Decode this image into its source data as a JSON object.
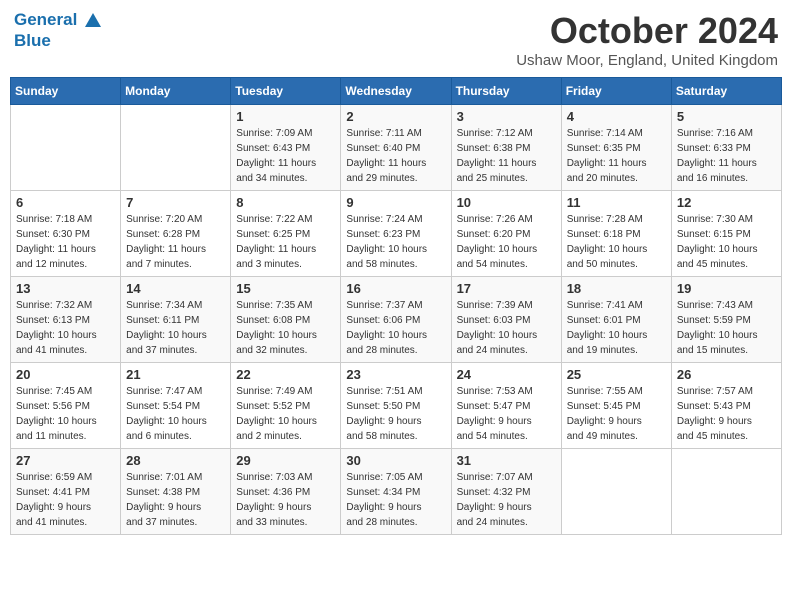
{
  "header": {
    "logo_line1": "General",
    "logo_line2": "Blue",
    "month_title": "October 2024",
    "location": "Ushaw Moor, England, United Kingdom"
  },
  "days_of_week": [
    "Sunday",
    "Monday",
    "Tuesday",
    "Wednesday",
    "Thursday",
    "Friday",
    "Saturday"
  ],
  "weeks": [
    [
      {
        "day": "",
        "info": ""
      },
      {
        "day": "",
        "info": ""
      },
      {
        "day": "1",
        "info": "Sunrise: 7:09 AM\nSunset: 6:43 PM\nDaylight: 11 hours\nand 34 minutes."
      },
      {
        "day": "2",
        "info": "Sunrise: 7:11 AM\nSunset: 6:40 PM\nDaylight: 11 hours\nand 29 minutes."
      },
      {
        "day": "3",
        "info": "Sunrise: 7:12 AM\nSunset: 6:38 PM\nDaylight: 11 hours\nand 25 minutes."
      },
      {
        "day": "4",
        "info": "Sunrise: 7:14 AM\nSunset: 6:35 PM\nDaylight: 11 hours\nand 20 minutes."
      },
      {
        "day": "5",
        "info": "Sunrise: 7:16 AM\nSunset: 6:33 PM\nDaylight: 11 hours\nand 16 minutes."
      }
    ],
    [
      {
        "day": "6",
        "info": "Sunrise: 7:18 AM\nSunset: 6:30 PM\nDaylight: 11 hours\nand 12 minutes."
      },
      {
        "day": "7",
        "info": "Sunrise: 7:20 AM\nSunset: 6:28 PM\nDaylight: 11 hours\nand 7 minutes."
      },
      {
        "day": "8",
        "info": "Sunrise: 7:22 AM\nSunset: 6:25 PM\nDaylight: 11 hours\nand 3 minutes."
      },
      {
        "day": "9",
        "info": "Sunrise: 7:24 AM\nSunset: 6:23 PM\nDaylight: 10 hours\nand 58 minutes."
      },
      {
        "day": "10",
        "info": "Sunrise: 7:26 AM\nSunset: 6:20 PM\nDaylight: 10 hours\nand 54 minutes."
      },
      {
        "day": "11",
        "info": "Sunrise: 7:28 AM\nSunset: 6:18 PM\nDaylight: 10 hours\nand 50 minutes."
      },
      {
        "day": "12",
        "info": "Sunrise: 7:30 AM\nSunset: 6:15 PM\nDaylight: 10 hours\nand 45 minutes."
      }
    ],
    [
      {
        "day": "13",
        "info": "Sunrise: 7:32 AM\nSunset: 6:13 PM\nDaylight: 10 hours\nand 41 minutes."
      },
      {
        "day": "14",
        "info": "Sunrise: 7:34 AM\nSunset: 6:11 PM\nDaylight: 10 hours\nand 37 minutes."
      },
      {
        "day": "15",
        "info": "Sunrise: 7:35 AM\nSunset: 6:08 PM\nDaylight: 10 hours\nand 32 minutes."
      },
      {
        "day": "16",
        "info": "Sunrise: 7:37 AM\nSunset: 6:06 PM\nDaylight: 10 hours\nand 28 minutes."
      },
      {
        "day": "17",
        "info": "Sunrise: 7:39 AM\nSunset: 6:03 PM\nDaylight: 10 hours\nand 24 minutes."
      },
      {
        "day": "18",
        "info": "Sunrise: 7:41 AM\nSunset: 6:01 PM\nDaylight: 10 hours\nand 19 minutes."
      },
      {
        "day": "19",
        "info": "Sunrise: 7:43 AM\nSunset: 5:59 PM\nDaylight: 10 hours\nand 15 minutes."
      }
    ],
    [
      {
        "day": "20",
        "info": "Sunrise: 7:45 AM\nSunset: 5:56 PM\nDaylight: 10 hours\nand 11 minutes."
      },
      {
        "day": "21",
        "info": "Sunrise: 7:47 AM\nSunset: 5:54 PM\nDaylight: 10 hours\nand 6 minutes."
      },
      {
        "day": "22",
        "info": "Sunrise: 7:49 AM\nSunset: 5:52 PM\nDaylight: 10 hours\nand 2 minutes."
      },
      {
        "day": "23",
        "info": "Sunrise: 7:51 AM\nSunset: 5:50 PM\nDaylight: 9 hours\nand 58 minutes."
      },
      {
        "day": "24",
        "info": "Sunrise: 7:53 AM\nSunset: 5:47 PM\nDaylight: 9 hours\nand 54 minutes."
      },
      {
        "day": "25",
        "info": "Sunrise: 7:55 AM\nSunset: 5:45 PM\nDaylight: 9 hours\nand 49 minutes."
      },
      {
        "day": "26",
        "info": "Sunrise: 7:57 AM\nSunset: 5:43 PM\nDaylight: 9 hours\nand 45 minutes."
      }
    ],
    [
      {
        "day": "27",
        "info": "Sunrise: 6:59 AM\nSunset: 4:41 PM\nDaylight: 9 hours\nand 41 minutes."
      },
      {
        "day": "28",
        "info": "Sunrise: 7:01 AM\nSunset: 4:38 PM\nDaylight: 9 hours\nand 37 minutes."
      },
      {
        "day": "29",
        "info": "Sunrise: 7:03 AM\nSunset: 4:36 PM\nDaylight: 9 hours\nand 33 minutes."
      },
      {
        "day": "30",
        "info": "Sunrise: 7:05 AM\nSunset: 4:34 PM\nDaylight: 9 hours\nand 28 minutes."
      },
      {
        "day": "31",
        "info": "Sunrise: 7:07 AM\nSunset: 4:32 PM\nDaylight: 9 hours\nand 24 minutes."
      },
      {
        "day": "",
        "info": ""
      },
      {
        "day": "",
        "info": ""
      }
    ]
  ]
}
